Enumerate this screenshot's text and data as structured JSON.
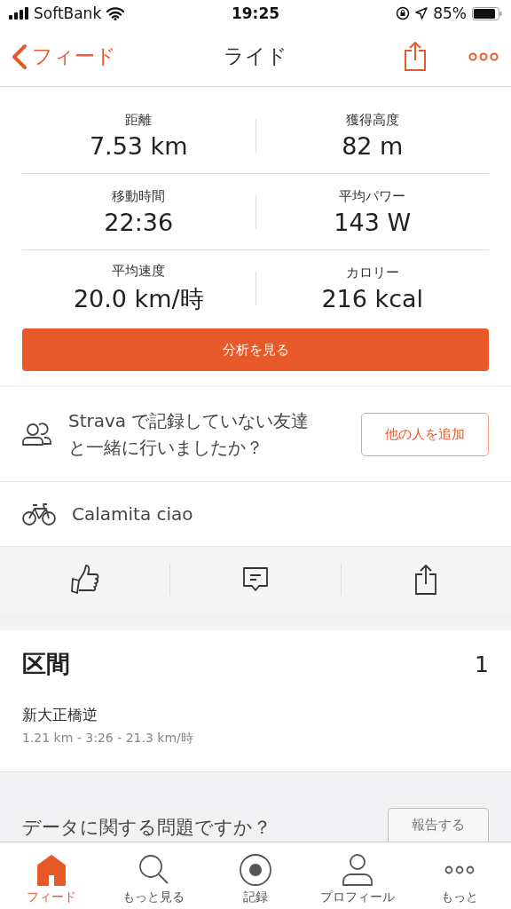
{
  "status_bar": {
    "carrier": "SoftBank",
    "time": "19:25",
    "battery": "85%"
  },
  "nav": {
    "back": "フィード",
    "title": "ライド"
  },
  "stats": [
    {
      "label": "距離",
      "value": "7.53 km"
    },
    {
      "label": "獲得高度",
      "value": "82 m"
    },
    {
      "label": "移動時間",
      "value": "22:36"
    },
    {
      "label": "平均パワー",
      "value": "143 W"
    },
    {
      "label": "平均速度",
      "value": "20.0 km/時"
    },
    {
      "label": "カロリー",
      "value": "216 kcal"
    }
  ],
  "analysis_button": "分析を見る",
  "friends_prompt": {
    "text": "Strava で記録していない友達と一緒に行いましたか？",
    "button": "他の人を追加"
  },
  "gear": "Calamita ciao",
  "segments": {
    "title": "区間",
    "count": "1",
    "items": [
      {
        "name": "新大正橋逆",
        "detail": "1.21 km - 3:26 - 21.3 km/時"
      }
    ]
  },
  "report": {
    "text": "データに関する問題ですか？",
    "button": "報告する"
  },
  "tabs": [
    {
      "label": "フィード",
      "kind": "home",
      "selected": true
    },
    {
      "label": "もっと見る",
      "kind": "search",
      "selected": false
    },
    {
      "label": "記録",
      "kind": "record",
      "selected": false
    },
    {
      "label": "プロフィール",
      "kind": "profile",
      "selected": false
    },
    {
      "label": "もっと",
      "kind": "more",
      "selected": false
    }
  ]
}
